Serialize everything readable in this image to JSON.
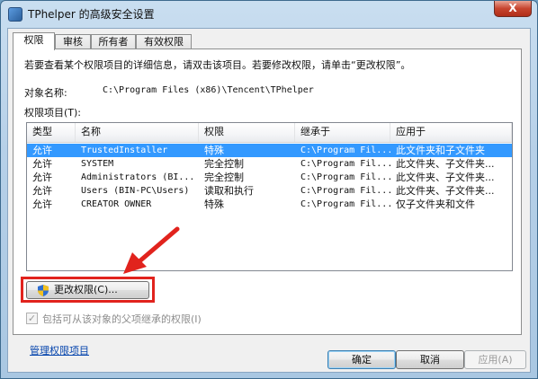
{
  "window": {
    "title": "TPhelper 的高级安全设置",
    "close_glyph": "X"
  },
  "tabs": [
    "权限",
    "审核",
    "所有者",
    "有效权限"
  ],
  "description": "若要查看某个权限项目的详细信息，请双击该项目。若要修改权限，请单击“更改权限”。",
  "object": {
    "label": "对象名称:",
    "value": "C:\\Program Files (x86)\\Tencent\\TPhelper"
  },
  "permissions": {
    "label": "权限项目(T):",
    "columns": [
      "类型",
      "名称",
      "权限",
      "继承于",
      "应用于"
    ],
    "rows": [
      {
        "type": "允许",
        "name": "TrustedInstaller",
        "perm": "特殊",
        "inherited": "C:\\Program Fil...",
        "applies": "此文件夹和子文件夹",
        "selected": true
      },
      {
        "type": "允许",
        "name": "SYSTEM",
        "perm": "完全控制",
        "inherited": "C:\\Program Fil...",
        "applies": "此文件夹、子文件夹...",
        "selected": false
      },
      {
        "type": "允许",
        "name": "Administrators (BI...",
        "perm": "完全控制",
        "inherited": "C:\\Program Fil...",
        "applies": "此文件夹、子文件夹...",
        "selected": false
      },
      {
        "type": "允许",
        "name": "Users (BIN-PC\\Users)",
        "perm": "读取和执行",
        "inherited": "C:\\Program Fil...",
        "applies": "此文件夹、子文件夹...",
        "selected": false
      },
      {
        "type": "允许",
        "name": "CREATOR OWNER",
        "perm": "特殊",
        "inherited": "C:\\Program Fil...",
        "applies": "仅子文件夹和文件",
        "selected": false
      }
    ]
  },
  "change_button": {
    "label": "更改权限(C)...",
    "icon": "uac-shield-icon"
  },
  "inherit_checkbox": {
    "label": "包括可从该对象的父项继承的权限(I)",
    "checked": true,
    "disabled": true
  },
  "manage_link": "管理权限项目",
  "buttons": {
    "ok": "确定",
    "cancel": "取消",
    "apply": "应用(A)"
  },
  "colors": {
    "selection": "#3399ff",
    "highlight": "#e1231d",
    "link": "#0645ad"
  }
}
